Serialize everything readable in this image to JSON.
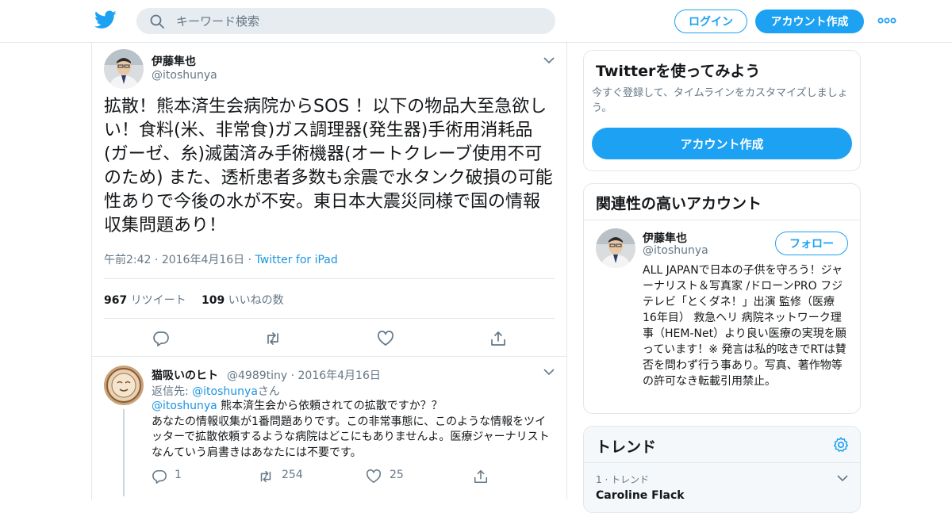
{
  "header": {
    "search_placeholder": "キーワード検索",
    "login_label": "ログイン",
    "signup_label": "アカウント作成"
  },
  "tweet": {
    "author_name": "伊藤隼也",
    "author_handle": "@itoshunya",
    "text": "拡散！熊本済生会病院からSOS ！以下の物品大至急欲しい！食料(米、非常食)ガス調理器(発生器)手術用消耗品(ガーゼ、糸)滅菌済み手術機器(オートクレーブ使用不可のため) また、透析患者多数も余震で水タンク破損の可能性ありで今後の水が不安。東日本大震災同様で国の情報収集問題あり！",
    "time": "午前2:42",
    "date": "2016年4月16日",
    "separator": " · ",
    "source": "Twitter for iPad",
    "retweet_count": "967",
    "retweet_label": "リツイート",
    "like_count": "109",
    "like_label": "いいねの数"
  },
  "reply": {
    "author_name": "猫吸いのヒト",
    "author_handle": "@4989tiny",
    "date": "· 2016年4月16日",
    "replyto_prefix": "返信先: ",
    "replyto_handle": "@itoshunya",
    "replyto_suffix": "さん",
    "mention": "@itoshunya",
    "text_line1": " 熊本済生会から依頼されての拡散ですか？？",
    "text_rest": "あなたの情報収集が1番問題ありです。この非常事態に、このような情報をツイッターで拡散依頼するような病院はどこにもありませんよ。医療ジャーナリストなんていう肩書きはあなたには不要です。",
    "reply_count": "1",
    "retweet_count": "254",
    "like_count": "25"
  },
  "sidebar": {
    "signup_card": {
      "title": "Twitterを使ってみよう",
      "description": "今すぐ登録して、タイムラインをカスタマイズしましょう。",
      "cta": "アカウント作成"
    },
    "related": {
      "title": "関連性の高いアカウント",
      "name": "伊藤隼也",
      "handle": "@itoshunya",
      "follow_label": "フォロー",
      "bio": "ALL JAPANで日本の子供を守ろう！ジャーナリスト＆写真家 /ドローンPRO フジテレビ「とくダネ！」出演 監修（医療 16年目） 救急ヘリ 病院ネットワーク理事（HEM-Net）より良い医療の実現を願っています！※ 発言は私的呟きでRTは賛否を問わず行う事あり。写真、著作物等の許可なき転載引用禁止。"
    },
    "trends": {
      "title": "トレンド",
      "item_meta": "1 · トレンド",
      "item_name": "Caroline Flack"
    }
  },
  "colors": {
    "brand": "#1da1f2",
    "link": "#1b95e0",
    "text": "#14171a",
    "muted": "#657786",
    "border": "#e1e8ed"
  },
  "icons": [
    "twitter-bird-icon",
    "search-icon",
    "more-dots-icon",
    "chevron-down-icon",
    "reply-icon",
    "retweet-icon",
    "like-icon",
    "share-icon",
    "gear-icon"
  ]
}
